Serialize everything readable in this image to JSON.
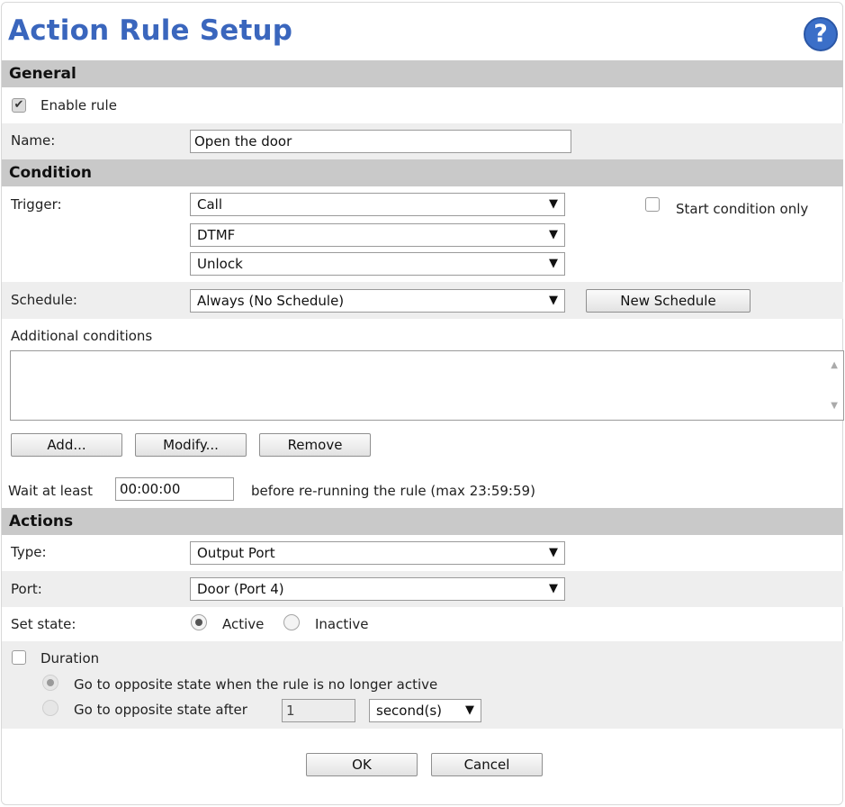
{
  "header": {
    "title": "Action Rule Setup",
    "help_icon": "?"
  },
  "general": {
    "section_label": "General",
    "enable_rule_label": "Enable rule",
    "enable_rule_checked": true,
    "name_label": "Name:",
    "name_value": "Open the door"
  },
  "condition": {
    "section_label": "Condition",
    "trigger_label": "Trigger:",
    "trigger_values": [
      "Call",
      "DTMF",
      "Unlock"
    ],
    "start_condition_only_label": "Start condition only",
    "start_condition_only_checked": false,
    "schedule_label": "Schedule:",
    "schedule_value": "Always (No Schedule)",
    "new_schedule_label": "New Schedule",
    "additional_conditions_label": "Additional conditions",
    "add_label": "Add...",
    "modify_label": "Modify...",
    "remove_label": "Remove",
    "wait_label": "Wait at least",
    "wait_value": "00:00:00",
    "wait_suffix": "before re-running the rule (max 23:59:59)"
  },
  "actions": {
    "section_label": "Actions",
    "type_label": "Type:",
    "type_value": "Output Port",
    "port_label": "Port:",
    "port_value": "Door (Port 4)",
    "set_state_label": "Set state:",
    "active_label": "Active",
    "inactive_label": "Inactive",
    "state_selected": "Active",
    "duration_label": "Duration",
    "duration_checked": false,
    "opposite_when_inactive_label": "Go to opposite state when the rule is no longer active",
    "opposite_after_label": "Go to opposite state after",
    "opposite_after_value": "1",
    "unit_value": "second(s)"
  },
  "footer": {
    "ok_label": "OK",
    "cancel_label": "Cancel"
  },
  "colors": {
    "title": "#3a66bd",
    "section_bg": "#c9c9c9",
    "band_bg": "#eeeeee"
  }
}
